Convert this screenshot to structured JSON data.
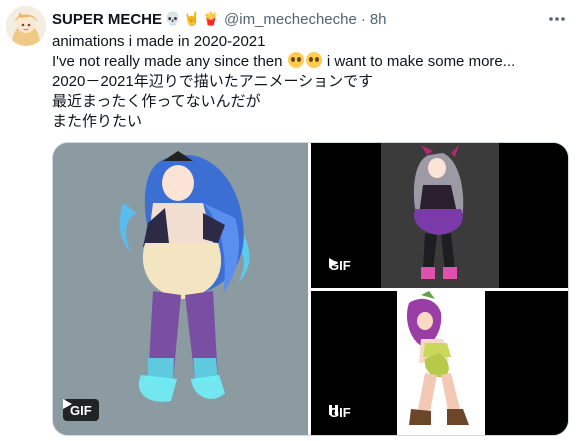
{
  "tweet": {
    "display_name": "SUPER MECHE",
    "name_emojis": [
      "skull-emoji",
      "rock-on-hand-emoji",
      "fries-emoji"
    ],
    "handle": "@im_mechecheche",
    "separator": "·",
    "time": "8h",
    "text": {
      "line1": "animations i made in 2020-2021",
      "line2_before": "I've not really made any since then",
      "line2_after": "i want to make some more...",
      "line3": "2020－2021年辺りで描いたアニメーションです",
      "line4": "最近まったく作ってないんだが",
      "line5": "また作りたい"
    },
    "inline_emojis": [
      "pleading-face-emoji",
      "pleading-face-emoji"
    ]
  },
  "media": {
    "items": [
      {
        "name": "gif-1",
        "badge": "GIF",
        "control": "play-icon",
        "style": "pill"
      },
      {
        "name": "gif-2",
        "badge": "GIF",
        "control": "play-icon",
        "style": "plain"
      },
      {
        "name": "gif-3",
        "badge": "GIF",
        "control": "pause-icon",
        "style": "plain"
      }
    ]
  },
  "colors": {
    "text": "#0f1419",
    "secondary": "#536471",
    "border": "#cfd9de",
    "gif_left_bg": "#8c9aa2",
    "gif_right_bg": "#000000"
  }
}
